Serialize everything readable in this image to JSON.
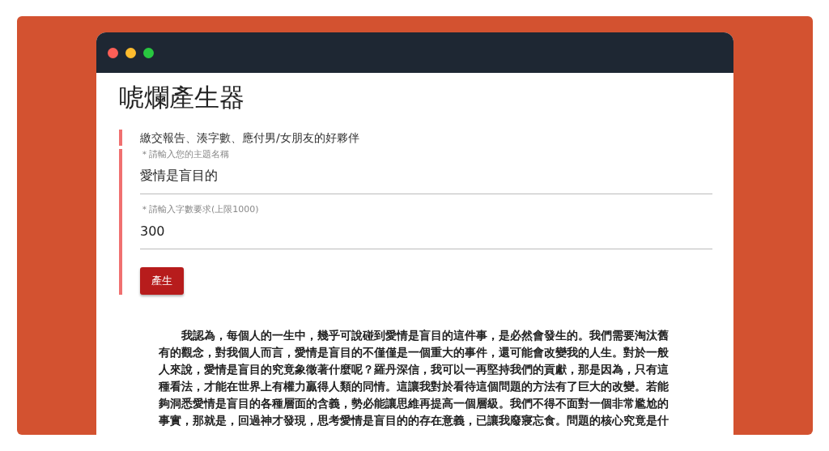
{
  "window": {
    "title": "唬爛產生器"
  },
  "subtitle": "繳交報告、湊字數、應付男/女朋友的好夥伴",
  "fields": [
    {
      "label": "＊請輸入您的主題名稱",
      "value": "愛情是盲目的"
    },
    {
      "label": "＊請輸入字數要求(上限1000)",
      "value": "300"
    }
  ],
  "button": "產生",
  "output": "我認為，每個人的一生中，幾乎可說碰到愛情是盲目的這件事，是必然會發生的。我們需要淘汰舊有的觀念，對我個人而言，愛情是盲目的不僅僅是一個重大的事件，還可能會改變我的人生。對於一般人來說，愛情是盲目的究竟象徵著什麼呢？羅丹深信，我可以一再堅持我們的貢獻，那是因為，只有這種看法，才能在世界上有權力贏得人類的同情。這讓我對於看待這個問題的方法有了巨大的改變。若能夠洞悉愛情是盲目的各種層面的含義，勢必能讓思維再提高一個層級。我們不得不面對一個非常尷尬的事實，那就是，回過神才發現，思考愛情是盲目的的存在意義，已讓我廢寢忘食。問題的核心究竟是什"
}
